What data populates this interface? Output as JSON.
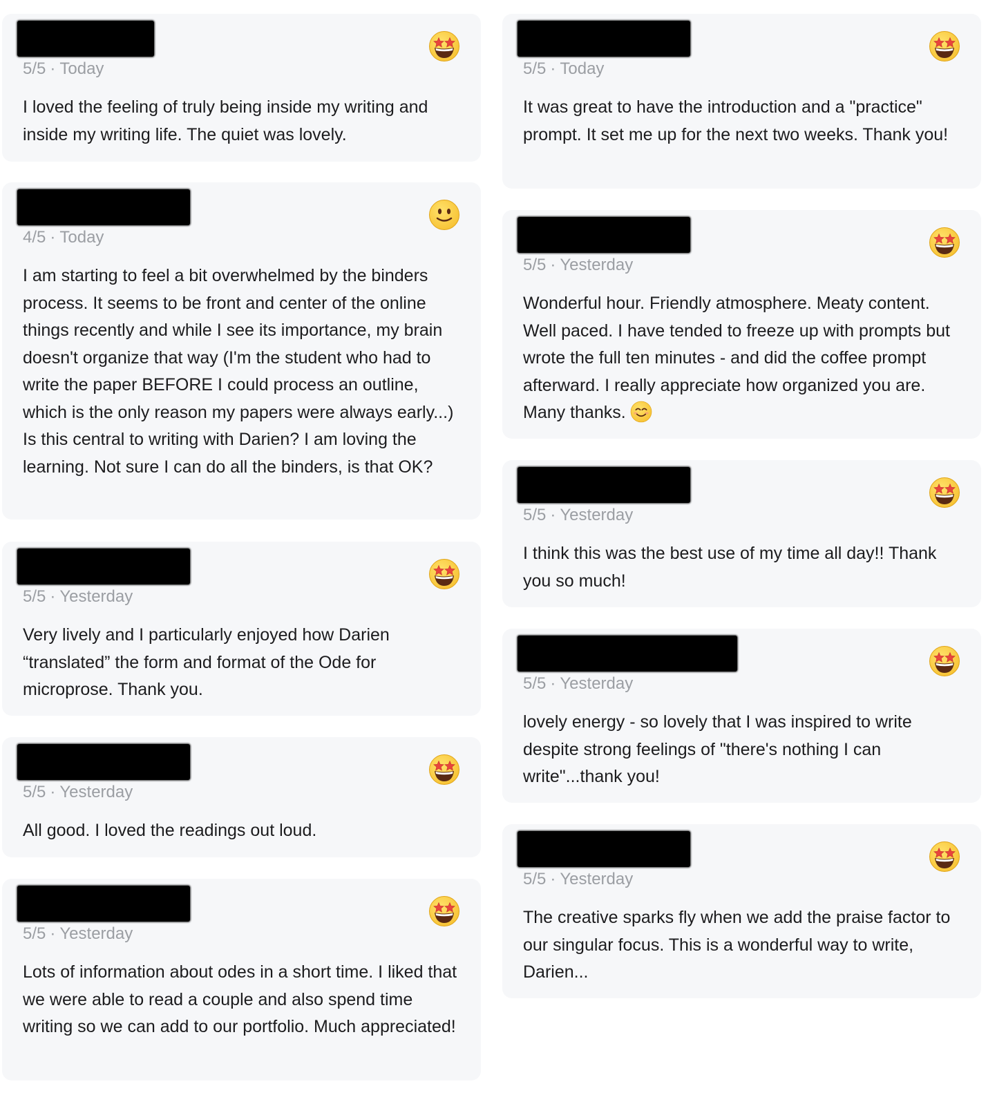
{
  "left_column": [
    {
      "rating": "5/5",
      "when": "Today",
      "emoji": "star-struck-icon",
      "comment": "I loved the feeling of truly being inside my writing and inside my writing life. The quiet was lovely."
    },
    {
      "rating": "4/5",
      "when": "Today",
      "emoji": "slightly-smiling-face-icon",
      "comment": "I am starting to feel a bit overwhelmed by the binders process. It seems to be front and center of the online things recently and while I see its importance, my brain doesn't organize that way (I'm the student who had to write the paper BEFORE I could process an outline, which is the only reason my papers were always early...) Is this central to writing with Darien? I am loving the learning. Not sure I can do all the binders, is that OK?"
    },
    {
      "rating": "5/5",
      "when": "Yesterday",
      "emoji": "star-struck-icon",
      "comment": "Very lively and I particularly enjoyed how Darien “translated” the form and format of the Ode for microprose. Thank you."
    },
    {
      "rating": "5/5",
      "when": "Yesterday",
      "emoji": "star-struck-icon",
      "comment": "All good. I loved the readings out loud."
    },
    {
      "rating": "5/5",
      "when": "Yesterday",
      "emoji": "star-struck-icon",
      "comment": "Lots of information about odes in a short time. I liked that we were able to read a couple and also spend time writing so we can add to our portfolio. Much appreciated!"
    }
  ],
  "right_column": [
    {
      "rating": "5/5",
      "when": "Today",
      "emoji": "star-struck-icon",
      "comment": "It was great to have the introduction and a \"practice\" prompt. It set me up for the next two weeks. Thank you!"
    },
    {
      "rating": "5/5",
      "when": "Yesterday",
      "emoji": "star-struck-icon",
      "comment": "Wonderful hour. Friendly atmosphere. Meaty content. Well paced. I have tended to freeze up with prompts but wrote the full ten minutes - and did the coffee prompt afterward. I really appreciate how organized you are. Many thanks.",
      "trailing_emoji": "smiling-face-with-smiling-eyes-icon"
    },
    {
      "rating": "5/5",
      "when": "Yesterday",
      "emoji": "star-struck-icon",
      "comment": "I think this was the best use of my time all day!! Thank you so much!"
    },
    {
      "rating": "5/5",
      "when": "Yesterday",
      "emoji": "star-struck-icon",
      "comment": "lovely energy - so lovely that I was inspired to write despite strong feelings of \"there's nothing I can write\"...thank you!"
    },
    {
      "rating": "5/5",
      "when": "Yesterday",
      "emoji": "star-struck-icon",
      "comment": "The creative sparks fly when we add the praise factor to our singular focus. This is a wonderful way to write, Darien..."
    }
  ],
  "separator": "·",
  "colors": {
    "card_background": "#f6f7f9",
    "meta_text": "#9b9ea3",
    "body_text": "#1c1c1e",
    "emoji_yellow": "#f7c234"
  }
}
